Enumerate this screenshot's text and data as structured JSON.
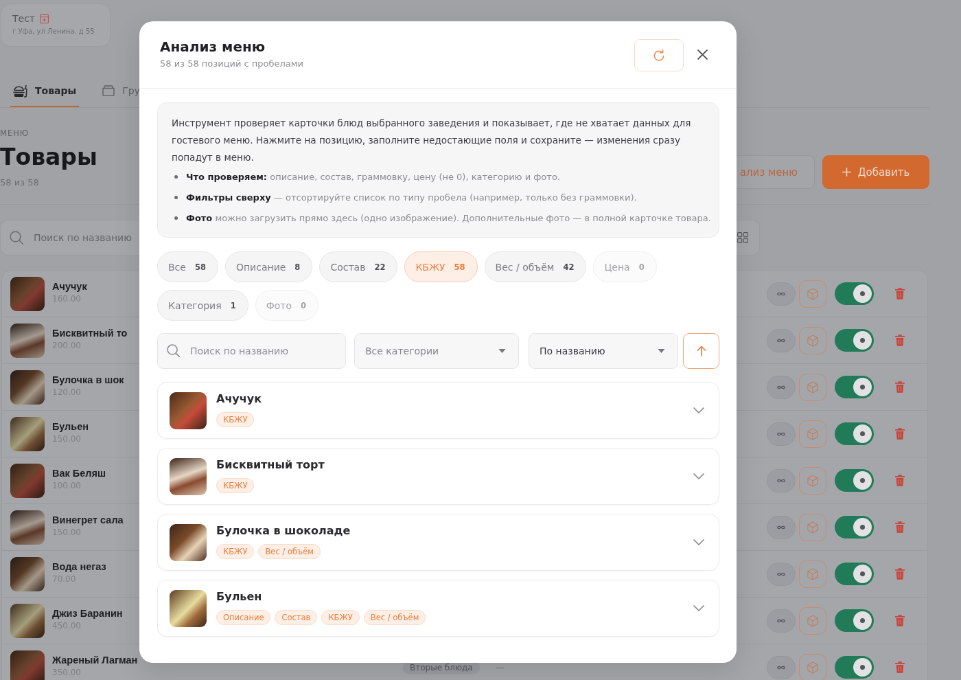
{
  "background": {
    "venue": {
      "name": "Тест",
      "address": "г Уфа, ул Ленина, д 55"
    },
    "tabs": [
      {
        "label": "Товары",
        "selected": true
      },
      {
        "label": "Гру",
        "selected": false
      }
    ],
    "section": "МЕНЮ",
    "title": "Товары",
    "count": "58 из 58",
    "actions": [
      {
        "kind": "outline",
        "label": "ализ меню"
      },
      {
        "kind": "primary",
        "label": "Добавить"
      }
    ],
    "search": {
      "placeholder": "Поиск по названию"
    },
    "products": [
      {
        "name": "Ачучук",
        "price": "160.00",
        "on": true
      },
      {
        "name": "Бисквитный то",
        "price": "200.00",
        "on": true
      },
      {
        "name": "Булочка в шок",
        "price": "120.00",
        "on": true
      },
      {
        "name": "Бульен",
        "price": "150.00",
        "on": true
      },
      {
        "name": "Вак Беляш",
        "price": "100.00",
        "on": true
      },
      {
        "name": "Винегрет сала",
        "price": "150.00",
        "on": true
      },
      {
        "name": "Вода негаз",
        "price": "70.00",
        "on": true
      },
      {
        "name": "Джиз Баранин",
        "price": "450.00",
        "on": true
      },
      {
        "name": "Жареный Лагман",
        "price": "350.00",
        "category": "Вторые блюда",
        "column_4": "—",
        "on": true
      }
    ]
  },
  "modal": {
    "title": "Анализ меню",
    "subtitle": "58 из 58 позиций с пробелами",
    "intro": "Инструмент проверяет карточки блюд выбранного заведения и показывает, где не хватает данных для гостевого меню. Нажмите на позицию, заполните недостающие поля и сохраните — изменения сразу попадут в меню.",
    "bullets": [
      "**Что проверяем:** описание, состав, граммовку, цену (не 0), категорию и фото.",
      "**Фильтры сверху** — отсортируйте список по типу пробела (например, только без граммовки).",
      "**Фото** можно загрузить прямо здесь (одно изображение). Дополнительные фото — в полной карточке товара."
    ],
    "filters": [
      {
        "label": "Все",
        "count": "58",
        "selected": false,
        "disabled": false
      },
      {
        "label": "Описание",
        "count": "8",
        "selected": false,
        "disabled": false
      },
      {
        "label": "Состав",
        "count": "22",
        "selected": false,
        "disabled": false
      },
      {
        "label": "КБЖУ",
        "count": "58",
        "selected": true,
        "disabled": false
      },
      {
        "label": "Вес / объём",
        "count": "42",
        "selected": false,
        "disabled": false
      },
      {
        "label": "Цена",
        "count": "0",
        "selected": false,
        "disabled": true
      },
      {
        "label": "Категория",
        "count": "1",
        "selected": false,
        "disabled": false
      },
      {
        "label": "Фото",
        "count": "0",
        "selected": false,
        "disabled": true
      }
    ],
    "search": {
      "placeholder": "Поиск по названию"
    },
    "selects": [
      {
        "value": "Все категории",
        "default": true
      },
      {
        "value": "По названию",
        "default": false
      }
    ],
    "sort_ascending": true,
    "items": [
      {
        "name": "Ачучук",
        "tags": [
          "КБЖУ"
        ],
        "expanded": false
      },
      {
        "name": "Бисквитный торт",
        "tags": [
          "КБЖУ"
        ],
        "expanded": false
      },
      {
        "name": "Булочка в шоколаде",
        "tags": [
          "КБЖУ",
          "Вес / объём"
        ],
        "expanded": false
      },
      {
        "name": "Бульен",
        "tags": [
          "Описание",
          "Состав",
          "КБЖУ",
          "Вес / объём"
        ],
        "expanded": false
      }
    ]
  }
}
